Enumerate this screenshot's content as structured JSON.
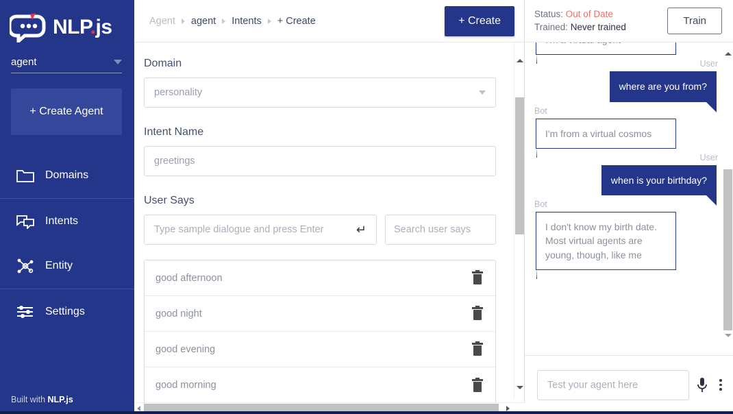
{
  "sidebar": {
    "logo_text": "NLP",
    "logo_dot": ".",
    "logo_suffix": "js",
    "agent_selector": "agent",
    "create_agent_label": "+ Create Agent",
    "items": [
      {
        "label": "Domains",
        "icon": "folder-icon"
      },
      {
        "label": "Intents",
        "icon": "chat-bubbles-icon"
      },
      {
        "label": "Entity",
        "icon": "entity-graph-icon"
      },
      {
        "label": "Settings",
        "icon": "sliders-icon"
      }
    ],
    "footer_prefix": "Built with ",
    "footer_brand": "NLP.js"
  },
  "header": {
    "breadcrumb": [
      "Agent",
      "agent",
      "Intents",
      "+ Create"
    ],
    "create_button": "+ Create"
  },
  "form": {
    "domain_label": "Domain",
    "domain_value": "personality",
    "intent_name_label": "Intent Name",
    "intent_name_value": "greetings",
    "user_says_label": "User Says",
    "user_says_placeholder": "Type sample dialogue and press Enter",
    "enter_glyph": "↵",
    "search_placeholder": "Search user says",
    "user_says_items": [
      "good afternoon",
      "good night",
      "good evening",
      "good morning"
    ]
  },
  "chat": {
    "status_label": "Status:",
    "status_value": "Out of Date",
    "trained_label": "Trained:",
    "trained_value": "Never trained",
    "train_button": "Train",
    "role_user": "User",
    "role_bot": "Bot",
    "messages": [
      {
        "role": "bot",
        "text": "I'm a virtual agent"
      },
      {
        "role": "user",
        "text": "where are you from?"
      },
      {
        "role": "bot",
        "text": "I'm from a virtual cosmos"
      },
      {
        "role": "user",
        "text": "when is your birthday?"
      },
      {
        "role": "bot",
        "text": "I don't know my birth date. Most virtual agents are young, though, like me"
      }
    ],
    "input_placeholder": "Test your agent here",
    "mic_icon": "microphone-icon",
    "menu_icon": "more-vertical-icon"
  },
  "colors": {
    "brand_navy": "#23368a",
    "accent_red": "#e8334a",
    "status_warning": "#f26d63"
  }
}
